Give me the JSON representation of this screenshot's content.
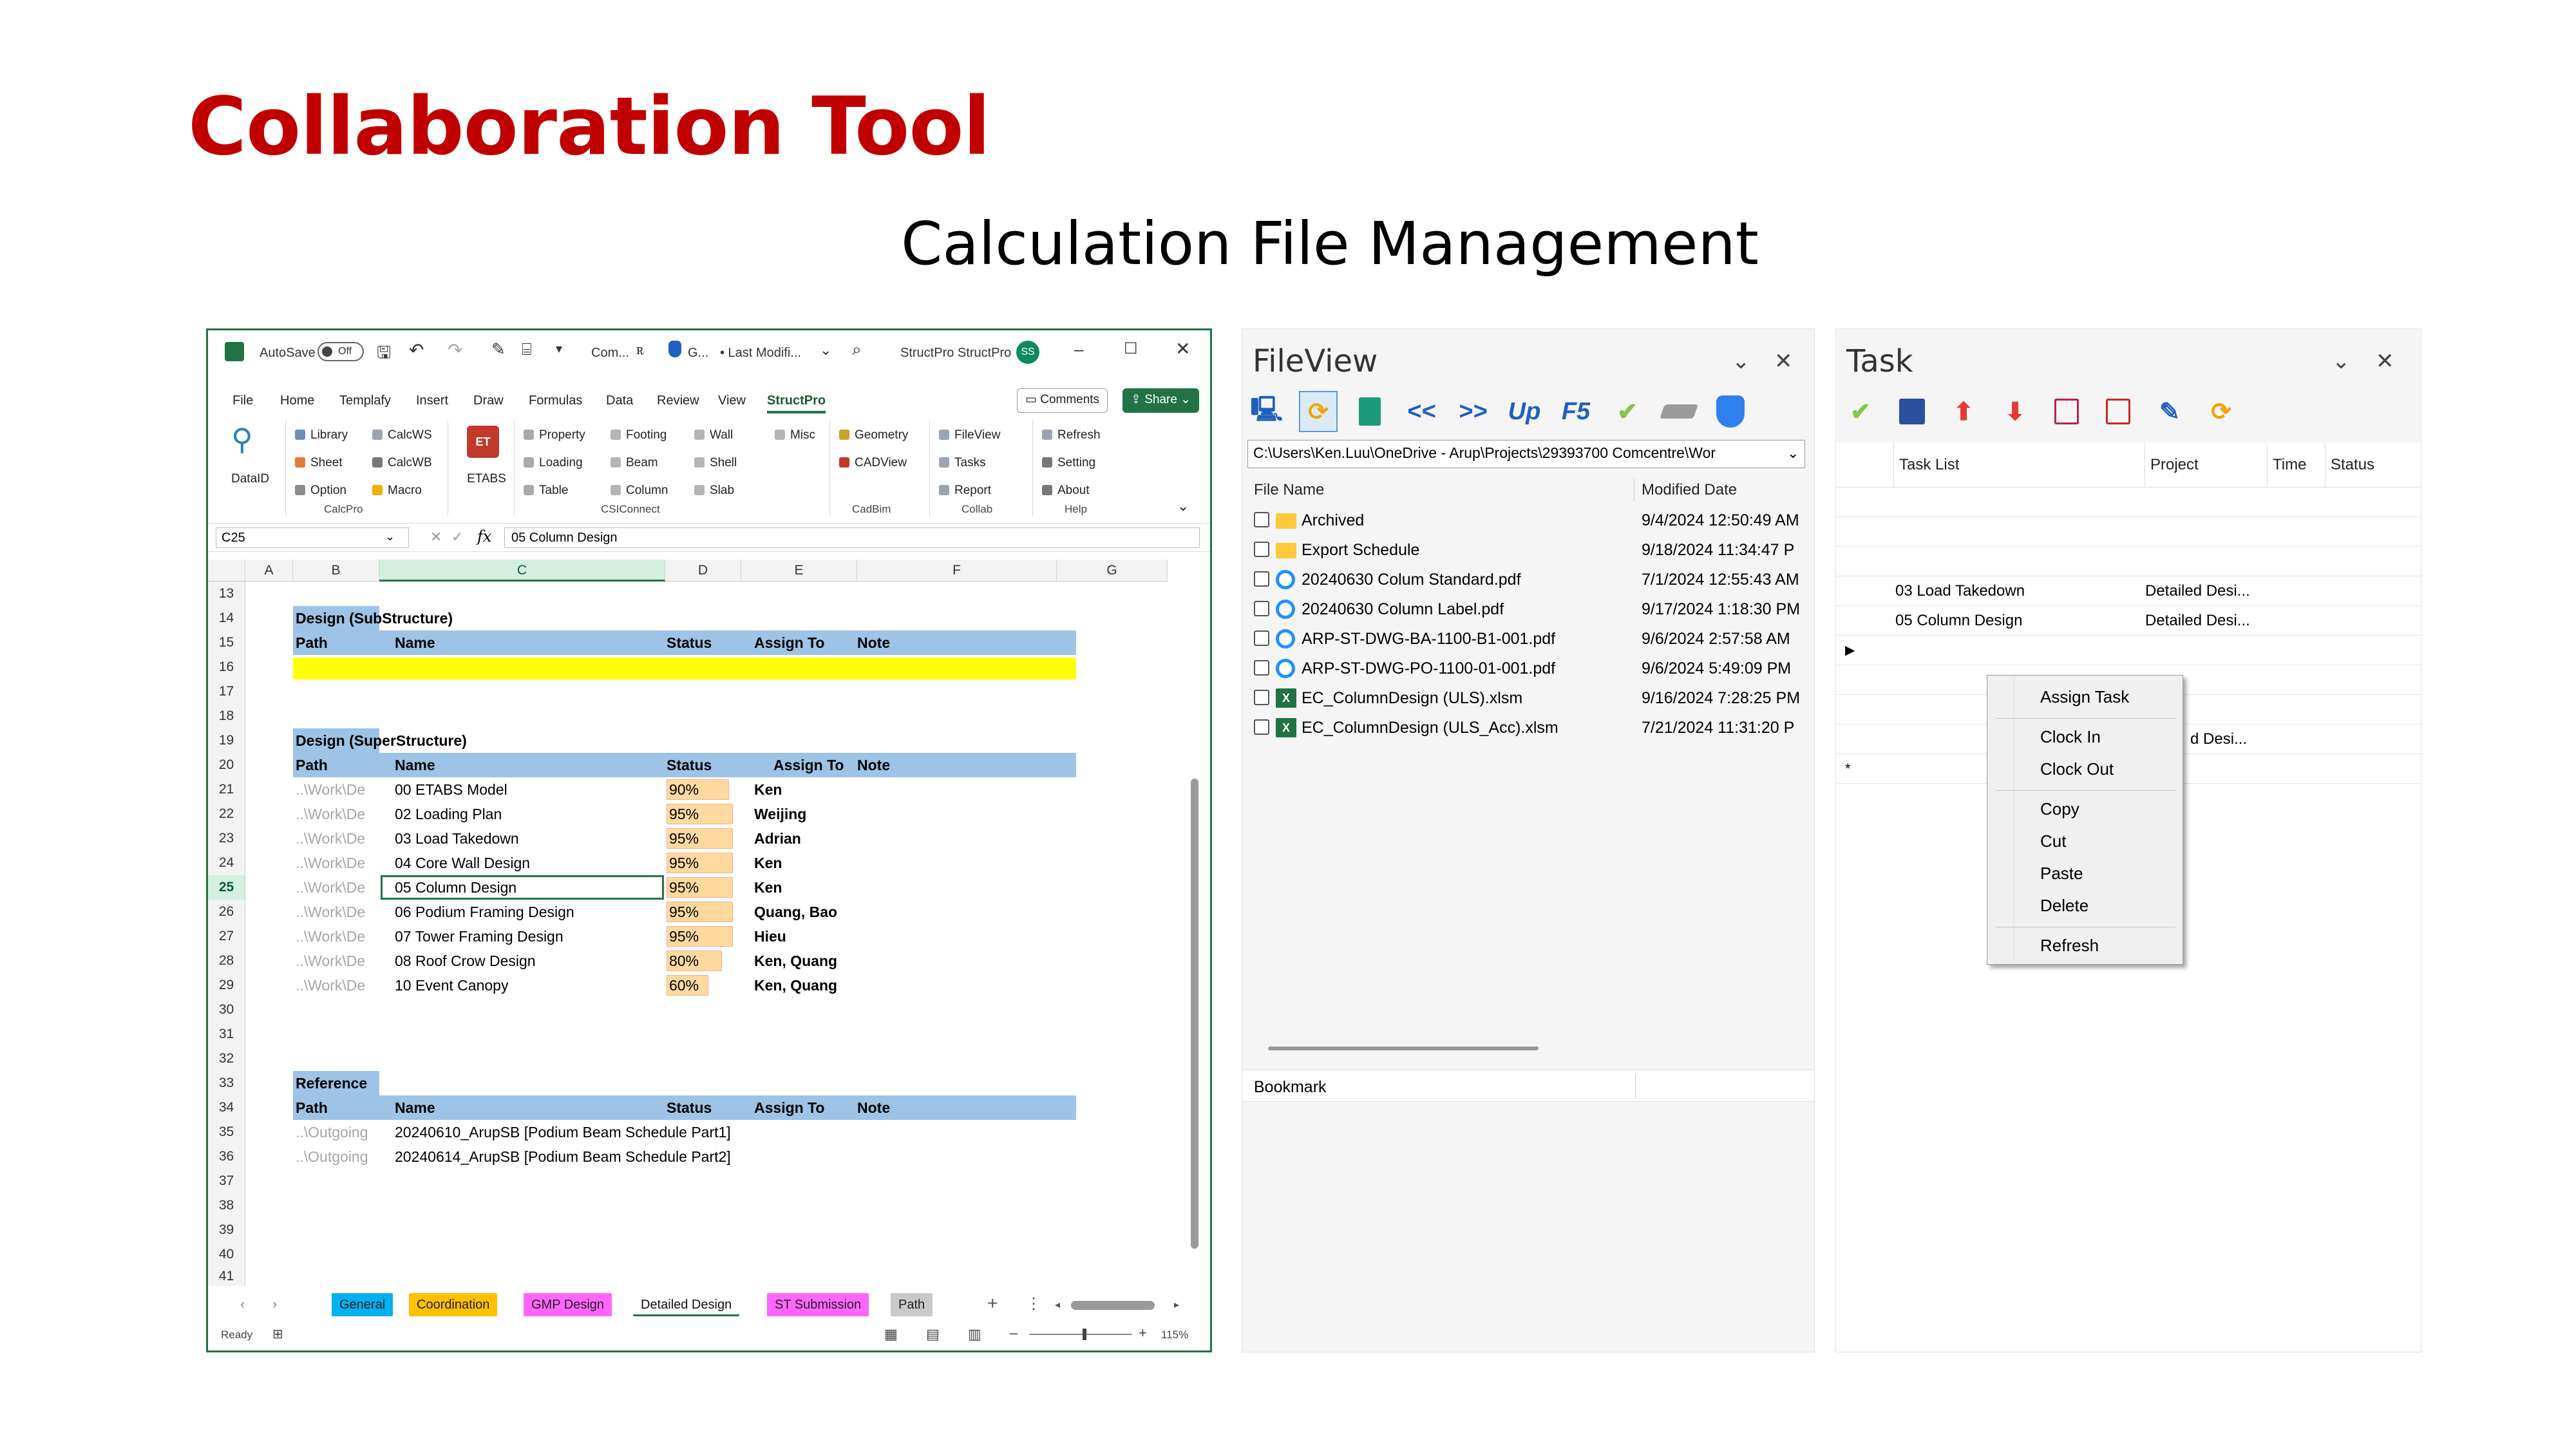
{
  "slide": {
    "title": "Collaboration Tool",
    "subtitle": "Calculation File Management"
  },
  "excel": {
    "titlebar": {
      "autosave_label": "AutoSave",
      "autosave_state": "Off",
      "doc_short": "Com...",
      "sens_label": "G...",
      "last_modified": "• Last Modifi...",
      "account": "StructPro StructPro",
      "avatar_initials": "SS"
    },
    "menus": [
      "File",
      "Home",
      "Templafy",
      "Insert",
      "Draw",
      "Formulas",
      "Data",
      "Review",
      "View",
      "StructPro"
    ],
    "comments_label": "Comments",
    "share_label": "Share",
    "ribbon": {
      "dataid": "DataID",
      "calcpro": [
        "Library",
        "Sheet",
        "Option",
        "CalcWS",
        "CalcWB",
        "Macro"
      ],
      "calcpro_label": "CalcPro",
      "etabs": "ETABS",
      "csiconnect": [
        "Property",
        "Loading",
        "Table",
        "Footing",
        "Beam",
        "Column",
        "Wall",
        "Shell",
        "Slab",
        "Misc"
      ],
      "csiconnect_label": "CSIConnect",
      "cadbim": [
        "Geometry",
        "CADView"
      ],
      "cadbim_label": "CadBim",
      "collab": [
        "FileView",
        "Tasks",
        "Report"
      ],
      "collab_label": "Collab",
      "help": [
        "Refresh",
        "Setting",
        "About"
      ],
      "help_label": "Help"
    },
    "name_box": "C25",
    "formula": "05 Column Design",
    "fx": "fx",
    "columns": [
      "A",
      "B",
      "C",
      "D",
      "E",
      "F",
      "G"
    ],
    "rows": {
      "r13": "13",
      "r14": "14",
      "r15": "15",
      "r16": "16",
      "r17": "17",
      "r18": "18",
      "r19": "19",
      "r20": "20",
      "r21": "21",
      "r22": "22",
      "r23": "23",
      "r24": "24",
      "r25": "25",
      "r26": "26",
      "r27": "27",
      "r28": "28",
      "r29": "29",
      "r30": "30",
      "r31": "31",
      "r32": "32",
      "r33": "33",
      "r34": "34",
      "r35": "35",
      "r36": "36",
      "r37": "37",
      "r38": "38",
      "r39": "39",
      "r40": "40",
      "r41": "41"
    },
    "sub_title": "Design (SubStructure)",
    "super_title": "Design (SuperStructure)",
    "ref_title": "Reference",
    "header": {
      "path": "Path",
      "name": "Name",
      "status": "Status",
      "assign": "Assign To",
      "note": "Note"
    },
    "design_rows": [
      {
        "path": "..\\Work\\De",
        "name": "00 ETABS Model",
        "status": "90%",
        "pct": 0.9,
        "assign": "Ken"
      },
      {
        "path": "..\\Work\\De",
        "name": "02 Loading Plan",
        "status": "95%",
        "pct": 0.95,
        "assign": "Weijing"
      },
      {
        "path": "..\\Work\\De",
        "name": "03 Load Takedown",
        "status": "95%",
        "pct": 0.95,
        "assign": "Adrian"
      },
      {
        "path": "..\\Work\\De",
        "name": "04 Core Wall Design",
        "status": "95%",
        "pct": 0.95,
        "assign": "Ken"
      },
      {
        "path": "..\\Work\\De",
        "name": "05 Column Design",
        "status": "95%",
        "pct": 0.95,
        "assign": "Ken"
      },
      {
        "path": "..\\Work\\De",
        "name": "06 Podium Framing Design",
        "status": "95%",
        "pct": 0.95,
        "assign": "Quang, Bao"
      },
      {
        "path": "..\\Work\\De",
        "name": "07 Tower Framing Design",
        "status": "95%",
        "pct": 0.95,
        "assign": "Hieu"
      },
      {
        "path": "..\\Work\\De",
        "name": "08 Roof Crow Design",
        "status": "80%",
        "pct": 0.8,
        "assign": "Ken, Quang"
      },
      {
        "path": "..\\Work\\De",
        "name": "10 Event Canopy",
        "status": "60%",
        "pct": 0.6,
        "assign": "Ken, Quang"
      }
    ],
    "ref_rows": [
      {
        "path": "..\\Outgoing",
        "name": "20240610_ArupSB [Podium Beam Schedule Part1]"
      },
      {
        "path": "..\\Outgoing",
        "name": "20240614_ArupSB [Podium Beam Schedule Part2]"
      }
    ],
    "sheet_tabs": [
      {
        "label": "General",
        "color": "#00b0f0"
      },
      {
        "label": "Coordination",
        "color": "#ffc000"
      },
      {
        "label": "GMP Design",
        "color": "#ff66ff"
      },
      {
        "label": "Detailed Design",
        "color": "#ffffff"
      },
      {
        "label": "ST Submission",
        "color": "#ff66ff"
      },
      {
        "label": "Path",
        "color": "#c9c9c9"
      }
    ],
    "status_ready": "Ready",
    "zoom": "115%"
  },
  "fileview": {
    "title": "FileView",
    "path": "C:\\Users\\Ken.Luu\\OneDrive - Arup\\Projects\\29393700 Comcentre\\Wor",
    "col_name": "File Name",
    "col_date": "Modified Date",
    "files": [
      {
        "name": "Archived",
        "date": "9/4/2024 12:50:49 AM",
        "type": "folder"
      },
      {
        "name": "Export Schedule",
        "date": "9/18/2024 11:34:47 P",
        "type": "folder"
      },
      {
        "name": "20240630 Colum Standard.pdf",
        "date": "7/1/2024 12:55:43 AM",
        "type": "pdf"
      },
      {
        "name": "20240630 Column Label.pdf",
        "date": "9/17/2024 1:18:30 PM",
        "type": "pdf"
      },
      {
        "name": "ARP-ST-DWG-BA-1100-B1-001.pdf",
        "date": "9/6/2024 2:57:58 AM",
        "type": "pdf"
      },
      {
        "name": "ARP-ST-DWG-PO-1100-01-001.pdf",
        "date": "9/6/2024 5:49:09 PM",
        "type": "pdf"
      },
      {
        "name": "EC_ColumnDesign (ULS).xlsm",
        "date": "9/16/2024 7:28:25 PM",
        "type": "xlsm"
      },
      {
        "name": "EC_ColumnDesign (ULS_Acc).xlsm",
        "date": "7/21/2024 11:31:20 P",
        "type": "xlsm"
      }
    ],
    "toolbar_text": {
      "back": "<<",
      "forward": ">>",
      "up": "Up",
      "f5": "F5"
    },
    "bookmark": "Bookmark"
  },
  "task": {
    "title": "Task",
    "columns": {
      "task_list": "Task List",
      "project": "Project",
      "time": "Time",
      "status": "Status"
    },
    "rows": [
      {
        "task": "03 Load Takedown",
        "project": "Detailed Desi..."
      },
      {
        "task": "05 Column Design",
        "project": "Detailed Desi..."
      }
    ],
    "hidden_project": "d Desi...",
    "context_menu": [
      "Assign Task",
      "Clock In",
      "Clock Out",
      "Copy",
      "Cut",
      "Paste",
      "Delete",
      "Refresh"
    ]
  },
  "colors": {
    "title_red": "#c00000",
    "excel_green": "#217346",
    "header_blue": "#9dc3e6",
    "status_orange": "#ffd9a0",
    "highlight_yellow": "#ffff00"
  }
}
